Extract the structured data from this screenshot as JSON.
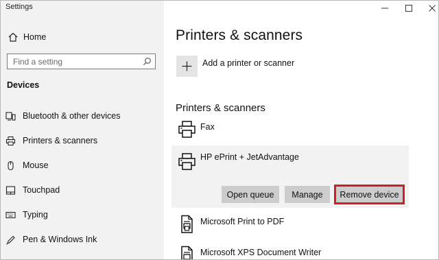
{
  "window": {
    "title": "Settings",
    "minimize_glyph": "—",
    "maximize_glyph": "☐",
    "close_glyph": "✕"
  },
  "sidebar": {
    "home_label": "Home",
    "search_placeholder": "Find a setting",
    "section_label": "Devices",
    "items": [
      {
        "label": "Bluetooth & other devices",
        "icon": "bluetooth-devices-icon"
      },
      {
        "label": "Printers & scanners",
        "icon": "printer-icon"
      },
      {
        "label": "Mouse",
        "icon": "mouse-icon"
      },
      {
        "label": "Touchpad",
        "icon": "touchpad-icon"
      },
      {
        "label": "Typing",
        "icon": "keyboard-icon"
      },
      {
        "label": "Pen & Windows Ink",
        "icon": "pen-icon"
      }
    ]
  },
  "main": {
    "title": "Printers & scanners",
    "add_label": "Add a printer or scanner",
    "list_heading": "Printers & scanners",
    "devices": [
      {
        "name": "Fax",
        "icon": "printer-icon"
      },
      {
        "name": "HP ePrint + JetAdvantage",
        "icon": "printer-icon",
        "selected": true
      },
      {
        "name": "Microsoft Print to PDF",
        "icon": "document-printer-icon"
      },
      {
        "name": "Microsoft XPS Document Writer",
        "icon": "document-printer-icon"
      }
    ],
    "actions": {
      "open_queue": "Open queue",
      "manage": "Manage",
      "remove_device": "Remove device"
    },
    "highlight_color": "#cc1f27"
  }
}
